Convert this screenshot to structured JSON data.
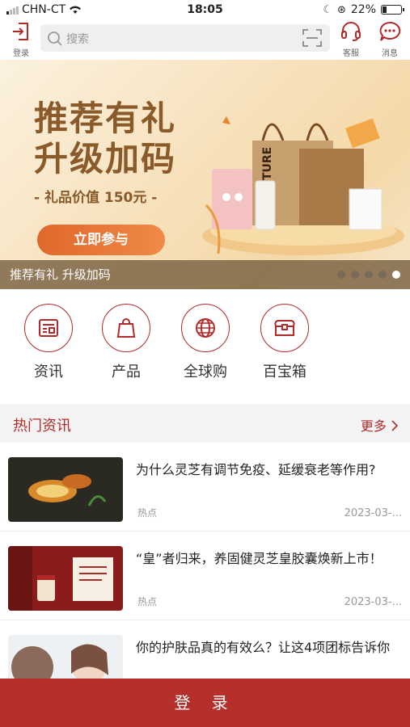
{
  "status": {
    "carrier": "CHN-CT",
    "time": "18:05",
    "battery": "22%"
  },
  "header": {
    "login_label": "登录",
    "search_placeholder": "搜索",
    "service_label": "客服",
    "message_label": "消息"
  },
  "banner": {
    "title_line1": "推荐有礼",
    "title_line2": "升级加码",
    "subtitle": "- 礼品价值 150元 -",
    "cta": "立即参与",
    "caption": "推荐有礼  升级加码",
    "slide_count": 5,
    "active_slide": 5,
    "bag_text": "FUTURE"
  },
  "quick_nav": [
    {
      "label": "资讯",
      "icon": "news-icon"
    },
    {
      "label": "产品",
      "icon": "bag-icon"
    },
    {
      "label": "全球购",
      "icon": "globe-icon"
    },
    {
      "label": "百宝箱",
      "icon": "treasure-box-icon"
    }
  ],
  "hot_news": {
    "title": "热门资讯",
    "more": "更多",
    "items": [
      {
        "title": "为什么灵芝有调节免疫、延缓衰老等作用?",
        "tag": "热点",
        "date": "2023-03-..."
      },
      {
        "title": "“皇”者归来，养固健灵芝皇胶囊焕新上市！",
        "tag": "热点",
        "date": "2023-03-..."
      },
      {
        "title": "你的护肤品真的有效么？让这4项团标告诉你",
        "tag": "",
        "date": ""
      }
    ]
  },
  "footer": {
    "login_button": "登 录"
  },
  "colors": {
    "accent": "#b22a2a",
    "login_bar": "#b5302a",
    "cta": "#e0672c"
  }
}
